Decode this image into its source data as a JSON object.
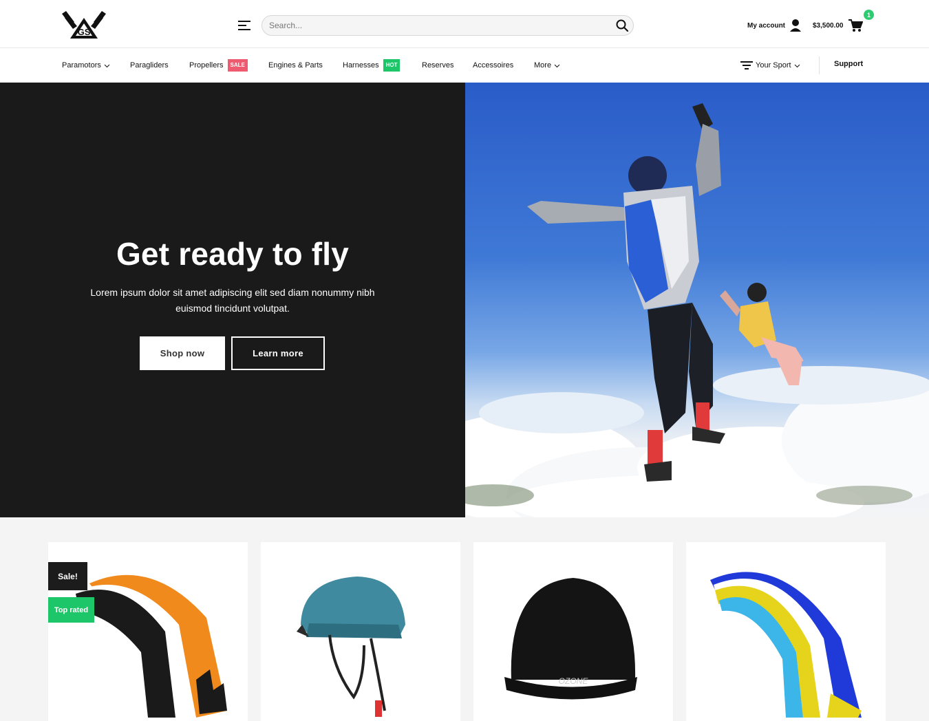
{
  "header": {
    "search_placeholder": "Search...",
    "account_label": "My account",
    "cart_total": "$3,500.00",
    "cart_count": "1"
  },
  "nav": {
    "items": [
      {
        "label": "Paramotors",
        "dropdown": true
      },
      {
        "label": "Paragliders"
      },
      {
        "label": "Propellers",
        "tag": "SALE"
      },
      {
        "label": "Engines & Parts"
      },
      {
        "label": "Harnesses",
        "tag": "HOT"
      },
      {
        "label": "Reserves"
      },
      {
        "label": "Accessoires"
      },
      {
        "label": "More",
        "dropdown": true
      }
    ],
    "your_sport": "Your Sport",
    "support": "Support"
  },
  "hero": {
    "title": "Get ready to fly",
    "subtitle": "Lorem ipsum dolor sit amet adipiscing elit sed diam nonummy nibh euismod tincidunt volutpat.",
    "shop_label": "Shop now",
    "learn_label": "Learn more"
  },
  "products": {
    "badges": {
      "sale": "Sale!",
      "top_rated": "Top rated"
    },
    "beanie_brand": "OZONE"
  },
  "colors": {
    "sale_tag": "#ee5a6f",
    "hot_tag": "#1ec66a",
    "cart_badge": "#2ecc71",
    "hero_bg": "#1a1a1a"
  }
}
